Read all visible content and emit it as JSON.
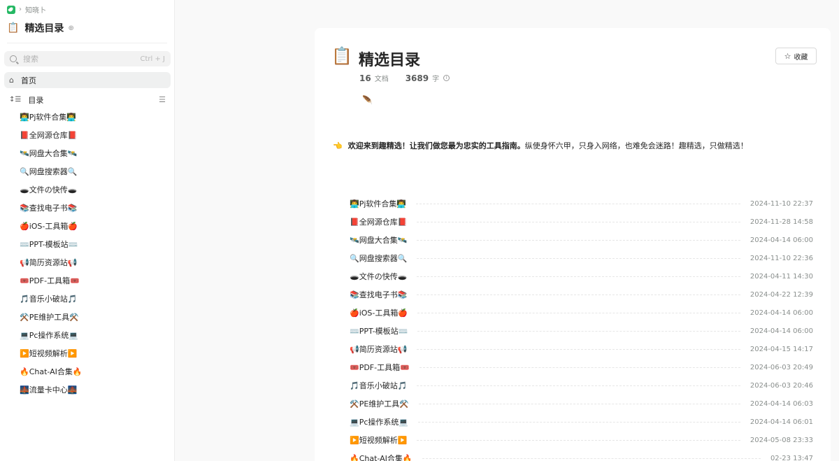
{
  "breadcrumb": {
    "space": "知晓卜"
  },
  "sidebar": {
    "book_icon": "📋",
    "book_title": "精选目录",
    "search_placeholder": "搜索",
    "search_shortcut": "Ctrl + J",
    "home_label": "首页",
    "toc_label": "目录",
    "items": [
      "👨‍💻Pj软件合集👨‍💻",
      "📕全网源仓库📕",
      "🛰️网盘大合集🛰️",
      "🔍网盘搜索器🔍",
      "🕳️文件の快传🕳️",
      "📚查找电子书📚",
      "🍎iOS-工具箱🍎",
      "⌨️PPT-模板站⌨️",
      "📢简历资源站📢",
      "🎟️PDF-工具箱🎟️",
      "🎵音乐小破站🎵",
      "⚒️PE维护工具⚒️",
      "💻Pc操作系统💻",
      "▶️短视频解析▶️",
      "🔥Chat-AI合集🔥",
      "🌉流量卡中心🌉"
    ]
  },
  "main": {
    "icon": "📋",
    "title": "精选目录",
    "favorite_label": "收藏",
    "doc_count": "16",
    "doc_unit": "文档",
    "word_count": "3689",
    "word_unit": "字",
    "leaf": "🪶",
    "welcome_emoji": "👈",
    "welcome_bold": "欢迎来到趣精选！让我们做您最为忠实的工具指南。",
    "welcome_rest": "纵使身怀六甲，只身入网络，也难免会迷路！趣精选，只做精选！",
    "docs": [
      {
        "title": "👨‍💻Pj软件合集👨‍💻",
        "date": "2024-11-10 22:37"
      },
      {
        "title": "📕全网源仓库📕",
        "date": "2024-11-28 14:58"
      },
      {
        "title": "🛰️网盘大合集🛰️",
        "date": "2024-04-14 06:00"
      },
      {
        "title": "🔍网盘搜索器🔍",
        "date": "2024-11-10 22:36"
      },
      {
        "title": "🕳️文件の快传🕳️",
        "date": "2024-04-11 14:30"
      },
      {
        "title": "📚查找电子书📚",
        "date": "2024-04-22 12:39"
      },
      {
        "title": "🍎iOS-工具箱🍎",
        "date": "2024-04-14 06:00"
      },
      {
        "title": "⌨️PPT-模板站⌨️",
        "date": "2024-04-14 06:00"
      },
      {
        "title": "📢简历资源站📢",
        "date": "2024-04-15 14:17"
      },
      {
        "title": "🎟️PDF-工具箱🎟️",
        "date": "2024-06-03 20:49"
      },
      {
        "title": "🎵音乐小破站🎵",
        "date": "2024-06-03 20:46"
      },
      {
        "title": "⚒️PE维护工具⚒️",
        "date": "2024-04-14 06:03"
      },
      {
        "title": "💻Pc操作系统💻",
        "date": "2024-04-14 06:01"
      },
      {
        "title": "▶️短视频解析▶️",
        "date": "2024-05-08 23:33"
      },
      {
        "title": "🔥Chat-AI合集🔥",
        "date": "02-23 13:47"
      }
    ]
  },
  "colors": {
    "accent": "#25b864",
    "muted": "#8a8f8d",
    "text": "#262626"
  },
  "icons": [
    "search-icon",
    "home-icon",
    "toc-icon",
    "star-icon",
    "info-icon",
    "logo-icon"
  ]
}
